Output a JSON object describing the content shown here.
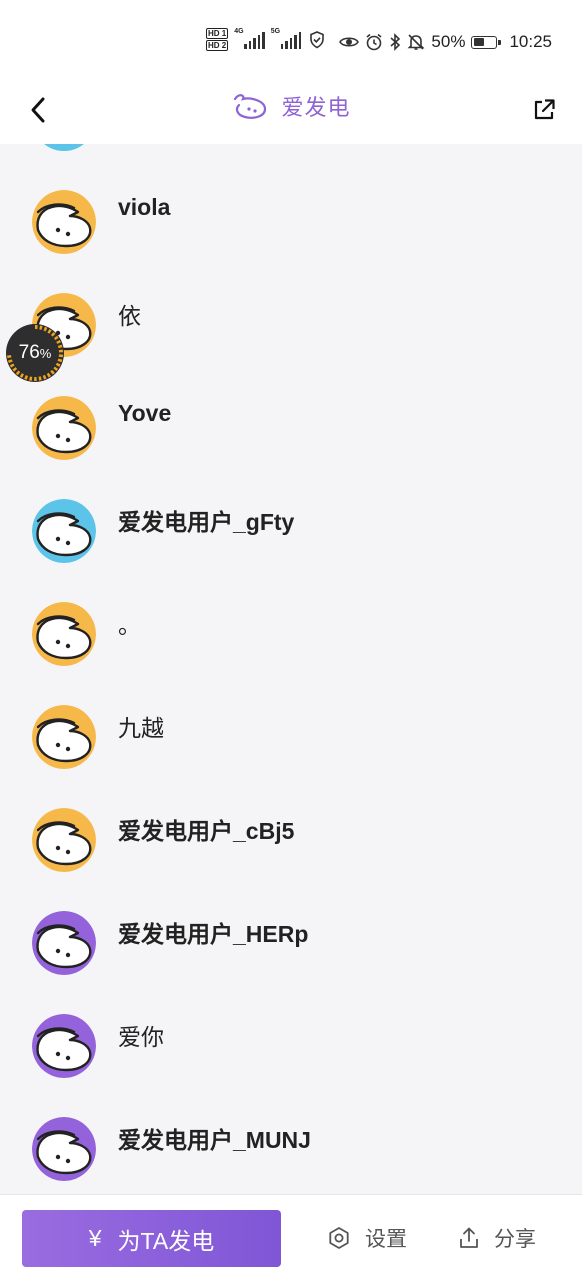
{
  "status_bar": {
    "hd1": "HD 1",
    "hd2": "HD 2",
    "net1": "4G",
    "net2": "5G",
    "battery_percent": "50%",
    "battery_level": 0.5,
    "time": "10:25"
  },
  "nav": {
    "title": "爱发电"
  },
  "floating_badge": {
    "value": "76",
    "unit": "%",
    "level": 0.76
  },
  "users": [
    {
      "name": "viola",
      "bold": true,
      "avatar_color": "#f7b84a"
    },
    {
      "name": "依",
      "bold": false,
      "avatar_color": "#f7b84a"
    },
    {
      "name": "Yove",
      "bold": true,
      "avatar_color": "#f7b84a"
    },
    {
      "name": "爱发电用户_gFty",
      "bold": true,
      "avatar_color": "#5bc4e8"
    },
    {
      "name": "。",
      "bold": false,
      "avatar_color": "#f7b84a"
    },
    {
      "name": "九越",
      "bold": false,
      "avatar_color": "#f7b84a"
    },
    {
      "name": "爱发电用户_cBj5",
      "bold": true,
      "avatar_color": "#f7b84a"
    },
    {
      "name": "爱发电用户_HERp",
      "bold": true,
      "avatar_color": "#9463dc"
    },
    {
      "name": "爱你",
      "bold": false,
      "avatar_color": "#9463dc"
    },
    {
      "name": "爱发电用户_MUNJ",
      "bold": true,
      "avatar_color": "#9463dc"
    }
  ],
  "partial_avatar_color": "#5bc4e8",
  "bottom_bar": {
    "support_icon": "¥",
    "support_label": "为TA发电",
    "settings_label": "设置",
    "share_label": "分享"
  },
  "colors": {
    "accent": "#8e63d6"
  }
}
